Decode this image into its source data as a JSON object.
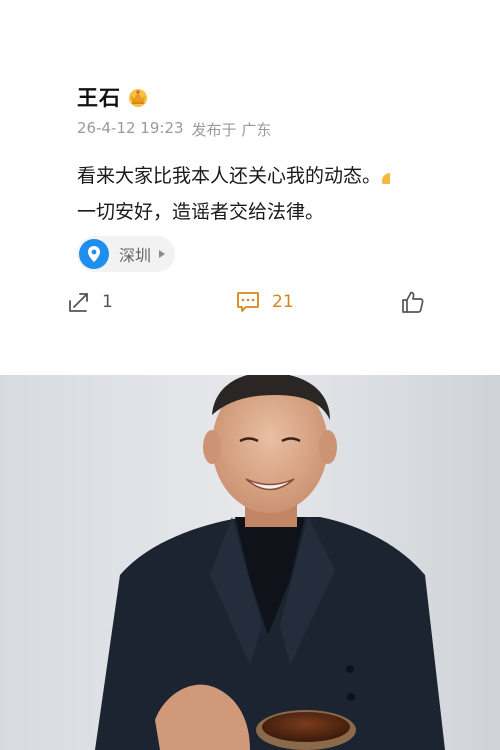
{
  "post": {
    "author": "王石",
    "badge_icon": "crown-icon",
    "timestamp": "26-4-12 19:23",
    "published_in": "发布于 广东",
    "text_line1": "看来大家比我本人还关心我的动态。",
    "text_line2": "一切安好，造谣者交给法律。",
    "location": "深圳",
    "location_icon": "location-pin-icon"
  },
  "actions": {
    "share_count": "1",
    "comment_count": "21",
    "share_icon": "share-icon",
    "comment_icon": "comment-icon",
    "like_icon": "thumbs-up-icon"
  },
  "colors": {
    "comment_accent": "#d6861a",
    "location_blue": "#1e8ff0",
    "meta_gray": "#9a9a9a"
  }
}
